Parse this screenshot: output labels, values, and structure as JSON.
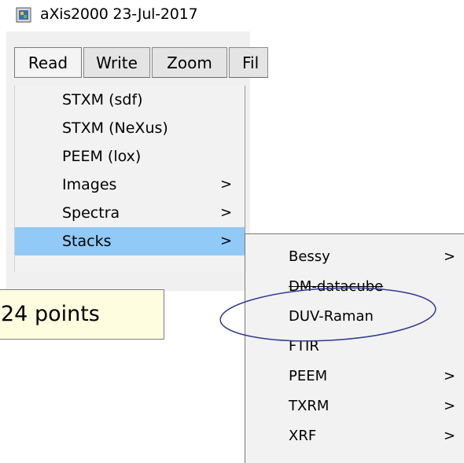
{
  "window": {
    "title": "aXis2000 23-Jul-2017",
    "icon": "app-icon"
  },
  "menubar": {
    "items": [
      {
        "label": "Read"
      },
      {
        "label": "Write"
      },
      {
        "label": "Zoom"
      },
      {
        "label": "Fil"
      }
    ]
  },
  "read_menu": {
    "items": [
      {
        "label": "STXM (sdf)",
        "arrow": ""
      },
      {
        "label": "STXM (NeXus)",
        "arrow": ""
      },
      {
        "label": "PEEM (lox)",
        "arrow": ""
      },
      {
        "label": "Images",
        "arrow": ">"
      },
      {
        "label": "Spectra",
        "arrow": ">"
      },
      {
        "label": "Stacks",
        "arrow": ">",
        "highlighted": true
      }
    ]
  },
  "stacks_submenu": {
    "items": [
      {
        "label": "Bessy",
        "arrow": ">"
      },
      {
        "label": "DM-datacube",
        "arrow": ""
      },
      {
        "label": "DUV-Raman",
        "arrow": ""
      },
      {
        "label": "FTIR",
        "arrow": ""
      },
      {
        "label": "PEEM",
        "arrow": ">"
      },
      {
        "label": "TXRM",
        "arrow": ">"
      },
      {
        "label": "XRF",
        "arrow": ">"
      }
    ]
  },
  "callout": {
    "text": "24 points"
  },
  "colors": {
    "highlight": "#91c9f7",
    "menu_bg": "#f2f2f2",
    "callout_bg": "#fefde0",
    "ellipse_stroke": "#2f3a8f"
  }
}
